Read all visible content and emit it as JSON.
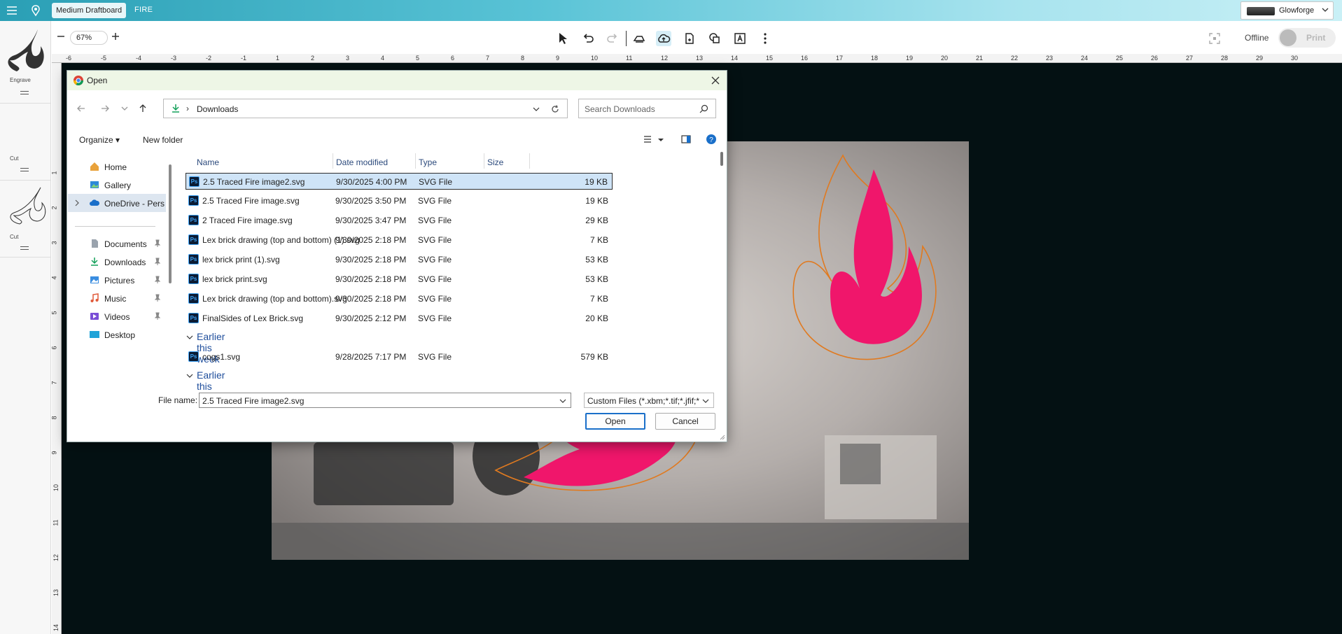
{
  "app": {
    "document_chip": "Medium Draftboard",
    "document_name": "FIRE",
    "printer_name": "Glowforge",
    "zoom": "67%",
    "offline_label": "Offline",
    "print_label": "Print"
  },
  "left_panel": {
    "thumbs": [
      {
        "op": "Engrave"
      },
      {
        "op": "Cut"
      },
      {
        "op": "Cut"
      }
    ]
  },
  "rulers": {
    "top": [
      "-6",
      "-5",
      "-4",
      "-3",
      "-2",
      "-1",
      "1",
      "2",
      "3",
      "4",
      "5",
      "6",
      "7",
      "8",
      "9",
      "10",
      "11",
      "12",
      "13",
      "14",
      "15",
      "16",
      "17",
      "18",
      "19",
      "20",
      "21",
      "22",
      "23",
      "24",
      "25",
      "26",
      "27",
      "28",
      "29",
      "30"
    ],
    "left": [
      "1",
      "2",
      "3",
      "4",
      "5",
      "6",
      "7",
      "8",
      "9",
      "10",
      "11",
      "12",
      "13",
      "14"
    ]
  },
  "dialog": {
    "title": "Open",
    "address_path": "Downloads",
    "search_placeholder": "Search Downloads",
    "organize_label": "Organize",
    "new_folder_label": "New folder",
    "nav": {
      "home": "Home",
      "gallery": "Gallery",
      "onedrive": "OneDrive - Pers",
      "documents": "Documents",
      "downloads": "Downloads",
      "pictures": "Pictures",
      "music": "Music",
      "videos": "Videos",
      "desktop": "Desktop"
    },
    "columns": {
      "name": "Name",
      "date": "Date modified",
      "type": "Type",
      "size": "Size"
    },
    "files": [
      {
        "name": "2.5 Traced Fire image2.svg",
        "date": "9/30/2025 4:00 PM",
        "type": "SVG File",
        "size": "19 KB"
      },
      {
        "name": "2.5 Traced Fire image.svg",
        "date": "9/30/2025 3:50 PM",
        "type": "SVG File",
        "size": "19 KB"
      },
      {
        "name": "2 Traced Fire image.svg",
        "date": "9/30/2025 3:47 PM",
        "type": "SVG File",
        "size": "29 KB"
      },
      {
        "name": "Lex brick drawing (top and bottom) (1).svg",
        "date": "9/30/2025 2:18 PM",
        "type": "SVG File",
        "size": "7 KB"
      },
      {
        "name": "lex brick print (1).svg",
        "date": "9/30/2025 2:18 PM",
        "type": "SVG File",
        "size": "53 KB"
      },
      {
        "name": "lex brick print.svg",
        "date": "9/30/2025 2:18 PM",
        "type": "SVG File",
        "size": "53 KB"
      },
      {
        "name": "Lex brick drawing (top and bottom).svg",
        "date": "9/30/2025 2:18 PM",
        "type": "SVG File",
        "size": "7 KB"
      },
      {
        "name": "FinalSides of Lex Brick.svg",
        "date": "9/30/2025 2:12 PM",
        "type": "SVG File",
        "size": "20 KB"
      }
    ],
    "group_week": "Earlier this week",
    "week_files": [
      {
        "name": "cogs1.svg",
        "date": "9/28/2025 7:17 PM",
        "type": "SVG File",
        "size": "579 KB"
      }
    ],
    "group_month": "Earlier this month",
    "file_name_label": "File name:",
    "file_name_value": "2.5 Traced Fire image2.svg",
    "filter_value": "Custom Files (*.xbm;*.tif;*.jfif;*.",
    "open_label": "Open",
    "cancel_label": "Cancel"
  },
  "colors": {
    "accent": "#1a6fc9",
    "flame": "#f0166b",
    "outline": "#e07a20"
  }
}
